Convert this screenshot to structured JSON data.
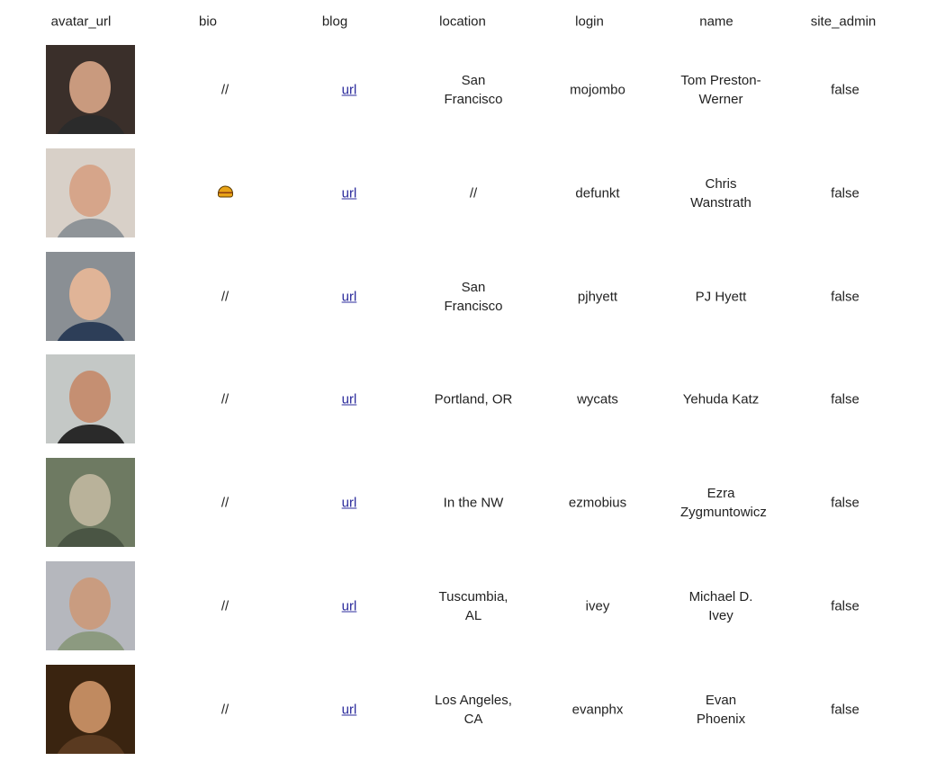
{
  "columns": [
    "avatar_url",
    "bio",
    "blog",
    "location",
    "login",
    "name",
    "site_admin"
  ],
  "rows": [
    {
      "bio": "//",
      "blog": "url",
      "location": "San Francisco",
      "login": "mojombo",
      "name": "Tom Preston-Werner",
      "site_admin": "false",
      "avatar_colors": [
        "#3a2f2a",
        "#c99a7e",
        "#2b2b2b"
      ]
    },
    {
      "bio": "burger-emoji",
      "blog": "url",
      "location": "//",
      "login": "defunkt",
      "name": "Chris Wanstrath",
      "site_admin": "false",
      "avatar_colors": [
        "#d8d0c8",
        "#d6a58a",
        "#8f9498"
      ]
    },
    {
      "bio": "//",
      "blog": "url",
      "location": "San Francisco",
      "login": "pjhyett",
      "name": "PJ Hyett",
      "site_admin": "false",
      "avatar_colors": [
        "#8a8f94",
        "#e0b497",
        "#2d3e58"
      ]
    },
    {
      "bio": "//",
      "blog": "url",
      "location": "Portland, OR",
      "login": "wycats",
      "name": "Yehuda Katz",
      "site_admin": "false",
      "avatar_colors": [
        "#c4c8c6",
        "#c58f72",
        "#2a2a2a"
      ]
    },
    {
      "bio": "//",
      "blog": "url",
      "location": "In the NW",
      "login": "ezmobius",
      "name": "Ezra Zygmuntowicz",
      "site_admin": "false",
      "avatar_colors": [
        "#6e7a62",
        "#b9b29a",
        "#4a5544"
      ]
    },
    {
      "bio": "//",
      "blog": "url",
      "location": "Tuscumbia, AL",
      "login": "ivey",
      "name": "Michael D. Ivey",
      "site_admin": "false",
      "avatar_colors": [
        "#b5b7bd",
        "#c99c80",
        "#8c9a80"
      ]
    },
    {
      "bio": "//",
      "blog": "url",
      "location": "Los Angeles, CA",
      "login": "evanphx",
      "name": "Evan Phoenix",
      "site_admin": "false",
      "avatar_colors": [
        "#3a2410",
        "#c08a60",
        "#5a3a20"
      ]
    }
  ]
}
